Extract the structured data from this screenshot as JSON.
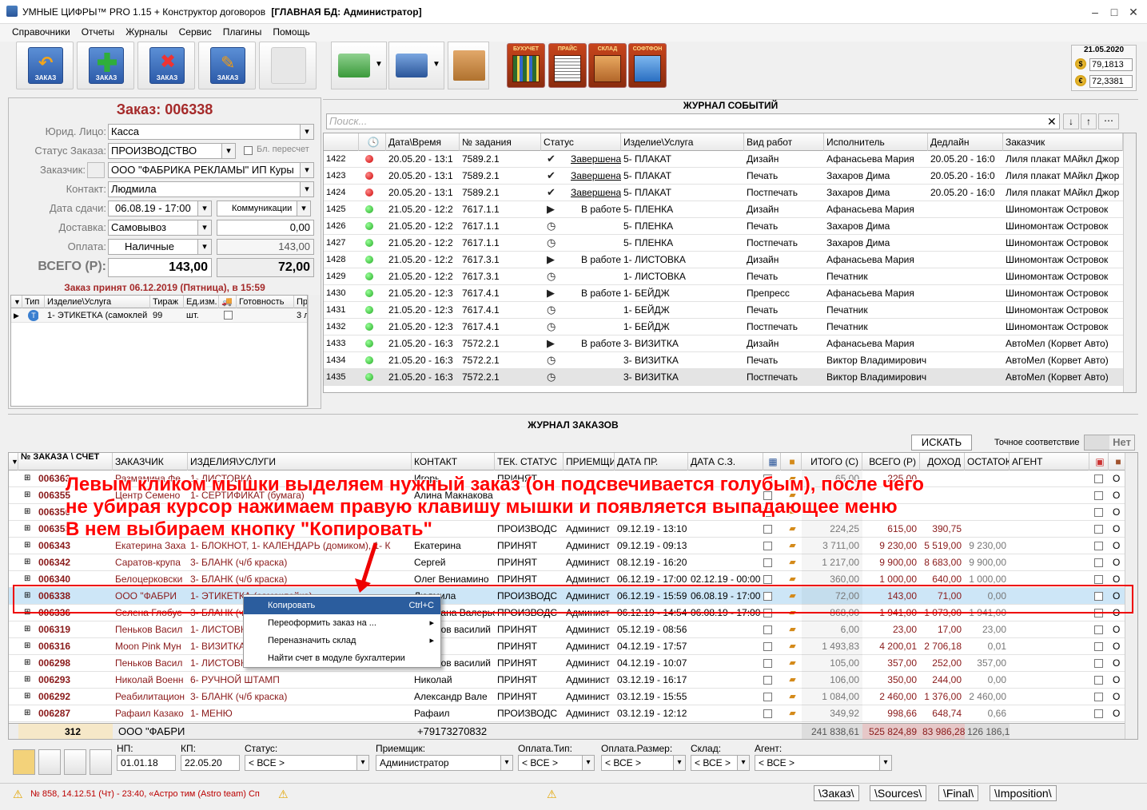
{
  "window": {
    "app": "УМНЫЕ ЦИФРЫ™ PRO 1.15",
    "module": "+ Конструктор договоров",
    "db": "[ГЛАВНАЯ БД: Администратор]"
  },
  "menu": [
    "Справочники",
    "Отчеты",
    "Журналы",
    "Сервис",
    "Плагины",
    "Помощь"
  ],
  "toolbar": {
    "icon_labels": {
      "zakaz": "ЗАКАЗ",
      "buh": "БУХУЧЕТ",
      "price": "ПРАЙС",
      "sklad": "СКЛАД",
      "softphone": "СОФТФОН"
    }
  },
  "currency": {
    "date": "21.05.2020",
    "usd": "79,1813",
    "eur": "72,3381"
  },
  "order": {
    "title": "Заказ: 006338",
    "labels": {
      "legal": "Юрид. Лицо:",
      "status": "Статус Заказа:",
      "customer": "Заказчик:",
      "contact": "Контакт:",
      "due": "Дата сдачи:",
      "delivery": "Доставка:",
      "payment": "Оплата:",
      "total": "ВСЕГО (Р):",
      "recalc": "Бл. пересчет",
      "comm": "Коммуникации"
    },
    "legal": "Касса",
    "status": "ПРОИЗВОДСТВО",
    "customer": "ООО \"ФАБРИКА РЕКЛАМЫ\" ИП Куры",
    "contact": "Людмила",
    "due": "06.08.19 - 17:00",
    "delivery": "Самовывоз",
    "delivery_cost": "0,00",
    "payment": "Наличные",
    "payment_sum": "143,00",
    "total": "143,00",
    "total2": "72,00",
    "accepted": "Заказ принят 06.12.2019 (Пятница), в 15:59",
    "items_cols": [
      "Тип",
      "Изделие\\Услуга",
      "Тираж",
      "Ед.изм.",
      "",
      "Готовность",
      "Пр"
    ],
    "items": [
      {
        "name": "1- ЭТИКЕТКА (самоклей",
        "qty": "99",
        "unit": "шт.",
        "extra": "3 л"
      }
    ]
  },
  "events": {
    "title": "ЖУРНАЛ СОБЫТИЙ",
    "search_placeholder": "Поиск...",
    "cols": [
      "",
      "Дата\\Время",
      "№ задания",
      "Статус",
      "Изделие\\Услуга",
      "Вид работ",
      "Исполнитель",
      "Дедлайн",
      "Заказчик"
    ],
    "rows": [
      {
        "id": "1422",
        "dot": "red",
        "dt": "20.05.20 - 13:1",
        "task": "7589.2.1",
        "st": "check",
        "stt": "Завершена",
        "item": "5- ПЛАКАТ",
        "work": "Дизайн",
        "exec": "Афанасьева Мария",
        "dl": "20.05.20 - 16:0",
        "cust": "Лиля плакат МАйкл Джор"
      },
      {
        "id": "1423",
        "dot": "red",
        "dt": "20.05.20 - 13:1",
        "task": "7589.2.1",
        "st": "check",
        "stt": "Завершена",
        "item": "5- ПЛАКАТ",
        "work": "Печать",
        "exec": "Захаров Дима",
        "dl": "20.05.20 - 16:0",
        "cust": "Лиля плакат МАйкл Джор"
      },
      {
        "id": "1424",
        "dot": "red",
        "dt": "20.05.20 - 13:1",
        "task": "7589.2.1",
        "st": "check",
        "stt": "Завершена",
        "item": "5- ПЛАКАТ",
        "work": "Постпечать",
        "exec": "Захаров Дима",
        "dl": "20.05.20 - 16:0",
        "cust": "Лиля плакат МАйкл Джор"
      },
      {
        "id": "1425",
        "dot": "green",
        "dt": "21.05.20 - 12:2",
        "task": "7617.1.1",
        "st": "play",
        "stt": "В работе",
        "item": "5- ПЛЕНКА",
        "work": "Дизайн",
        "exec": "Афанасьева Мария",
        "dl": "",
        "cust": "Шиномонтаж Островок"
      },
      {
        "id": "1426",
        "dot": "green",
        "dt": "21.05.20 - 12:2",
        "task": "7617.1.1",
        "st": "clock",
        "stt": "",
        "item": "5- ПЛЕНКА",
        "work": "Печать",
        "exec": "Захаров Дима",
        "dl": "",
        "cust": "Шиномонтаж Островок"
      },
      {
        "id": "1427",
        "dot": "green",
        "dt": "21.05.20 - 12:2",
        "task": "7617.1.1",
        "st": "clock",
        "stt": "",
        "item": "5- ПЛЕНКА",
        "work": "Постпечать",
        "exec": "Захаров Дима",
        "dl": "",
        "cust": "Шиномонтаж Островок"
      },
      {
        "id": "1428",
        "dot": "green",
        "dt": "21.05.20 - 12:2",
        "task": "7617.3.1",
        "st": "play",
        "stt": "В работе",
        "item": "1- ЛИСТОВКА",
        "work": "Дизайн",
        "exec": "Афанасьева Мария",
        "dl": "",
        "cust": "Шиномонтаж Островок"
      },
      {
        "id": "1429",
        "dot": "green",
        "dt": "21.05.20 - 12:2",
        "task": "7617.3.1",
        "st": "clock",
        "stt": "",
        "item": "1- ЛИСТОВКА",
        "work": "Печать",
        "exec": "Печатник",
        "dl": "",
        "cust": "Шиномонтаж Островок"
      },
      {
        "id": "1430",
        "dot": "green",
        "dt": "21.05.20 - 12:3",
        "task": "7617.4.1",
        "st": "play",
        "stt": "В работе",
        "item": "1- БЕЙДЖ",
        "work": "Препресс",
        "exec": "Афанасьева Мария",
        "dl": "",
        "cust": "Шиномонтаж Островок"
      },
      {
        "id": "1431",
        "dot": "green",
        "dt": "21.05.20 - 12:3",
        "task": "7617.4.1",
        "st": "clock",
        "stt": "",
        "item": "1- БЕЙДЖ",
        "work": "Печать",
        "exec": "Печатник",
        "dl": "",
        "cust": "Шиномонтаж Островок"
      },
      {
        "id": "1432",
        "dot": "green",
        "dt": "21.05.20 - 12:3",
        "task": "7617.4.1",
        "st": "clock",
        "stt": "",
        "item": "1- БЕЙДЖ",
        "work": "Постпечать",
        "exec": "Печатник",
        "dl": "",
        "cust": "Шиномонтаж Островок"
      },
      {
        "id": "1433",
        "dot": "green",
        "dt": "21.05.20 - 16:3",
        "task": "7572.2.1",
        "st": "play",
        "stt": "В работе",
        "item": "3- ВИЗИТКА",
        "work": "Дизайн",
        "exec": "Афанасьева Мария",
        "dl": "",
        "cust": "АвтоМел (Корвет Авто)"
      },
      {
        "id": "1434",
        "dot": "green",
        "dt": "21.05.20 - 16:3",
        "task": "7572.2.1",
        "st": "clock",
        "stt": "",
        "item": "3- ВИЗИТКА",
        "work": "Печать",
        "exec": "Виктор Владимирович",
        "dl": "",
        "cust": "АвтоМел (Корвет Авто)"
      },
      {
        "id": "1435",
        "dot": "green",
        "dt": "21.05.20 - 16:3",
        "task": "7572.2.1",
        "st": "clock",
        "stt": "",
        "item": "3- ВИЗИТКА",
        "work": "Постпечать",
        "exec": "Виктор Владимирович",
        "dl": "",
        "cust": "АвтоМел (Корвет Авто)"
      }
    ]
  },
  "orders": {
    "title": "ЖУРНАЛ ЗАКАЗОВ",
    "search_btn": "ИСКАТЬ",
    "exact_label": "Точное соответствие",
    "exact_val": "Нет",
    "cols": [
      "№ ЗАКАЗА \\ СЧЕТ",
      "ЗАКАЗЧИК",
      "ИЗДЕЛИЯ\\УСЛУГИ",
      "КОНТАКТ",
      "ТЕК. СТАТУС",
      "ПРИЕМЩИ",
      "ДАТА ПР.",
      "ДАТА С.З.",
      "",
      "",
      "ИТОГО (С)",
      "ВСЕГО (Р)",
      "ДОХОД",
      "ОСТАТОК",
      "АГЕНТ"
    ],
    "rows": [
      {
        "n": "006363",
        "c": "Размамина Фе",
        "i": "1- ЛИСТОВКА",
        "k": "Игорь",
        "s": "ПРИНЯТ",
        "p": "",
        "d1": "",
        "d2": "",
        "it": "65,00",
        "t": "225,00",
        "dh": "",
        "o": ""
      },
      {
        "n": "006355",
        "c": "Центр Семено",
        "i": "1- СЕРТИФИКАТ (бумага)",
        "k": "Алина Макнакова",
        "s": "",
        "p": "",
        "d1": "",
        "d2": "",
        "it": "",
        "t": "",
        "dh": "",
        "o": ""
      },
      {
        "n": "006350",
        "c": "",
        "i": "",
        "k": "",
        "s": "",
        "p": "",
        "d1": "",
        "d2": "",
        "it": "",
        "t": "",
        "dh": "",
        "o": ""
      },
      {
        "n": "006353",
        "c": "",
        "i": "",
        "k": "",
        "s": "ПРОИЗВОДС",
        "p": "Админист",
        "d1": "09.12.19 - 13:10",
        "d2": "",
        "it": "224,25",
        "t": "615,00",
        "dh": "390,75",
        "o": ""
      },
      {
        "n": "006343",
        "c": "Екатерина Заха",
        "i": "1- БЛОКНОТ, 1- КАЛЕНДАРЬ (домиком), 1- К",
        "k": "Екатерина",
        "s": "ПРИНЯТ",
        "p": "Админист",
        "d1": "09.12.19 - 09:13",
        "d2": "",
        "it": "3 711,00",
        "t": "9 230,00",
        "dh": "5 519,00",
        "o": "9 230,00"
      },
      {
        "n": "006342",
        "c": "Саратов-крупа",
        "i": "3- БЛАНК (ч/б краска)",
        "k": "Сергей",
        "s": "ПРИНЯТ",
        "p": "Админист",
        "d1": "08.12.19 - 16:20",
        "d2": "",
        "it": "1 217,00",
        "t": "9 900,00",
        "dh": "8 683,00",
        "o": "9 900,00"
      },
      {
        "n": "006340",
        "c": "Белоцерковски",
        "i": "3- БЛАНК (ч/б краска)",
        "k": "Олег Вениамино",
        "s": "ПРИНЯТ",
        "p": "Админист",
        "d1": "06.12.19 - 17:00",
        "d2": "02.12.19 - 00:00",
        "it": "360,00",
        "t": "1 000,00",
        "dh": "640,00",
        "o": "1 000,00"
      },
      {
        "n": "006338",
        "c": "ООО \"ФАБРИ",
        "i": "1- ЭТИКЕТКА (самоклейка)",
        "k": "Людмила",
        "s": "ПРОИЗВОДС",
        "p": "Админист",
        "d1": "06.12.19 - 15:59",
        "d2": "06.08.19 - 17:00",
        "it": "72,00",
        "t": "143,00",
        "dh": "71,00",
        "o": "0,00"
      },
      {
        "n": "006336",
        "c": "Селена Глобус",
        "i": "3- БЛАНК (ч/б краска)",
        "k": "Светлана Валерьевна",
        "s": "ПРОИЗВОДС",
        "p": "Админист",
        "d1": "06.12.19 - 14:54",
        "d2": "06.08.19 - 17:00",
        "it": "868,00",
        "t": "1 941,00",
        "dh": "1 073,00",
        "o": "1 941,00"
      },
      {
        "n": "006319",
        "c": "Пеньков Васил",
        "i": "1- ЛИСТОВКА",
        "k": "Пеньков василий",
        "s": "ПРИНЯТ",
        "p": "Админист",
        "d1": "05.12.19 - 08:56",
        "d2": "",
        "it": "6,00",
        "t": "23,00",
        "dh": "17,00",
        "o": "23,00"
      },
      {
        "n": "006316",
        "c": "Moon Pink Мун",
        "i": "1- ВИЗИТКА",
        "k": "",
        "s": "ПРИНЯТ",
        "p": "Админист",
        "d1": "04.12.19 - 17:57",
        "d2": "",
        "it": "1 493,83",
        "t": "4 200,01",
        "dh": "2 706,18",
        "o": "0,01"
      },
      {
        "n": "006298",
        "c": "Пеньков Васил",
        "i": "1- ЛИСТОВКА",
        "k": "Пеньков василий",
        "s": "ПРИНЯТ",
        "p": "Админист",
        "d1": "04.12.19 - 10:07",
        "d2": "",
        "it": "105,00",
        "t": "357,00",
        "dh": "252,00",
        "o": "357,00"
      },
      {
        "n": "006293",
        "c": "Николай Военн",
        "i": "6- РУЧНОЙ ШТАМП",
        "k": "Николай",
        "s": "ПРИНЯТ",
        "p": "Админист",
        "d1": "03.12.19 - 16:17",
        "d2": "",
        "it": "106,00",
        "t": "350,00",
        "dh": "244,00",
        "o": "0,00"
      },
      {
        "n": "006292",
        "c": "Реабилитацион",
        "i": "3- БЛАНК (ч/б краска)",
        "k": "Александр Вале",
        "s": "ПРИНЯТ",
        "p": "Админист",
        "d1": "03.12.19 - 15:55",
        "d2": "",
        "it": "1 084,00",
        "t": "2 460,00",
        "dh": "1 376,00",
        "o": "2 460,00"
      },
      {
        "n": "006287",
        "c": "Рафаил Казако",
        "i": "1- МЕНЮ",
        "k": "Рафаил",
        "s": "ПРОИЗВОДС",
        "p": "Админист",
        "d1": "03.12.19 - 12:12",
        "d2": "",
        "it": "349,92",
        "t": "998,66",
        "dh": "648,74",
        "o": "0,66"
      }
    ],
    "footer": {
      "count": "312",
      "cust": "ООО \"ФАБРИ",
      "phone": "+79173270832",
      "it": "241 838,61",
      "t": "525 824,89",
      "dh": "83 986,28",
      "o": "126 186,10"
    }
  },
  "context_menu": [
    {
      "label": "Копировать",
      "shortcut": "Ctrl+C"
    },
    {
      "label": "Переоформить заказ на ...",
      "sub": "▸"
    },
    {
      "label": "Переназначить склад",
      "sub": "▸"
    },
    {
      "label": "Найти счет в модуле бухгалтерии",
      "sub": ""
    }
  ],
  "annotation": [
    "Левым кликом мышки выделяем нужный заказ (он подсвечивается голубым), после чего",
    "не убирая курсор нажимаем правую клавишу мышки и появляется выпадающее меню",
    "В нем выбираем кнопку \"Копировать\""
  ],
  "filters": {
    "labels": {
      "np": "НП:",
      "kp": "КП:",
      "status": "Статус:",
      "receiver": "Приемщик:",
      "pay_type": "Оплата.Тип:",
      "pay_size": "Оплата.Размер:",
      "store": "Склад:",
      "agent": "Агент:"
    },
    "np": "01.01.18",
    "kp": "22.05.20",
    "status": "< ВСЕ >",
    "receiver": "Администратор",
    "pay_type": "< ВСЕ >",
    "pay_size": "< ВСЕ >",
    "store": "< ВСЕ >",
    "agent": "< ВСЕ >"
  },
  "statusbar": {
    "msg": "№ 858, 14.12.51 (Чт) - 23:40, «Астро тим (Astro team) Сп",
    "tabs": [
      "\\Заказ\\",
      "\\Sources\\",
      "\\Final\\",
      "\\Imposition\\"
    ]
  }
}
